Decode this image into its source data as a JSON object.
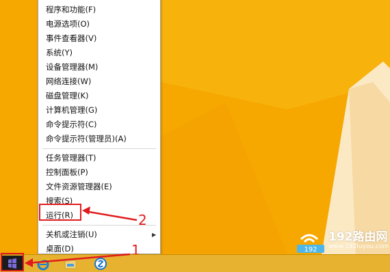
{
  "menu": {
    "items": [
      {
        "label": "程序和功能(F)"
      },
      {
        "label": "电源选项(O)"
      },
      {
        "label": "事件查看器(V)"
      },
      {
        "label": "系统(Y)"
      },
      {
        "label": "设备管理器(M)"
      },
      {
        "label": "网络连接(W)"
      },
      {
        "label": "磁盘管理(K)"
      },
      {
        "label": "计算机管理(G)"
      },
      {
        "label": "命令提示符(C)"
      },
      {
        "label": "命令提示符(管理员)(A)"
      },
      {
        "label": "任务管理器(T)"
      },
      {
        "label": "控制面板(P)"
      },
      {
        "label": "文件资源管理器(E)"
      },
      {
        "label": "搜索(S)"
      },
      {
        "label": "运行(R)"
      },
      {
        "label": "关机或注销(U)",
        "has_submenu": true
      },
      {
        "label": "桌面(D)"
      }
    ]
  },
  "annotations": {
    "step1": "1",
    "step2": "2",
    "color": "#e11b1b"
  },
  "taskbar": {
    "icons": [
      "windows-start-icon",
      "internet-explorer-icon",
      "file-explorer-icon",
      "store-icon"
    ]
  },
  "watermark": {
    "title": "192路由网",
    "url": "www.192luyou.com",
    "badge": "192"
  },
  "colors": {
    "desktop": "#f6a800",
    "menu_bg": "#ffffff",
    "taskbar": "#e6b230"
  }
}
